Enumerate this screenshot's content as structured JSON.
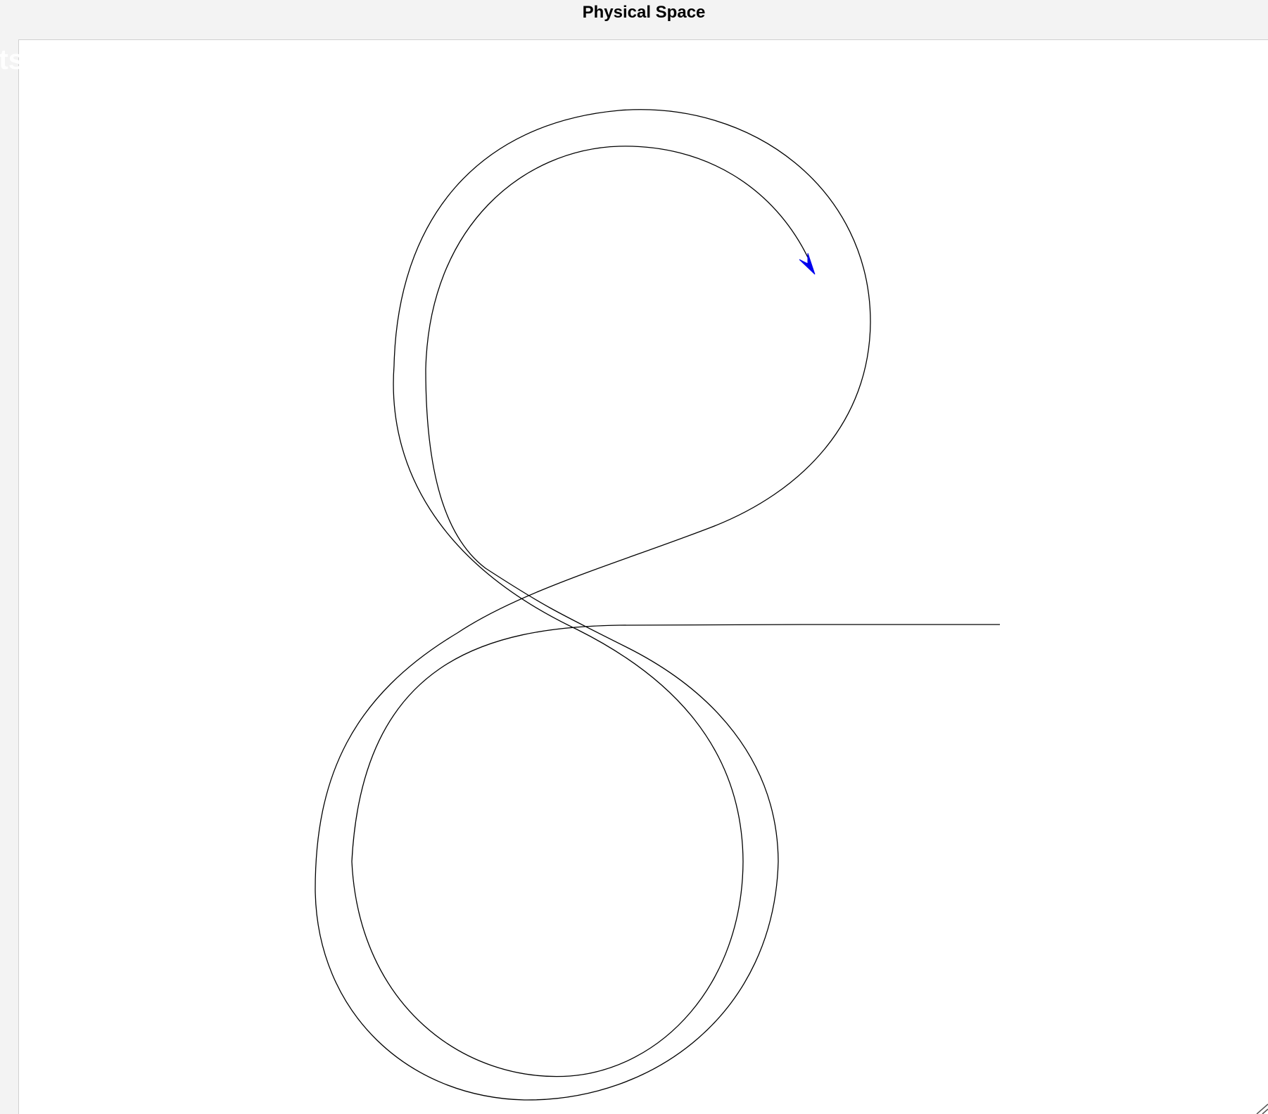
{
  "window": {
    "title": "Physical Space",
    "ghost_label": "nts"
  },
  "plot": {
    "path_color": "#000000",
    "arrow_color": "#0000ee",
    "background": "#ffffff"
  },
  "icons": {
    "arrow": "heading-arrow-icon",
    "grip": "resize-grip-icon"
  }
}
